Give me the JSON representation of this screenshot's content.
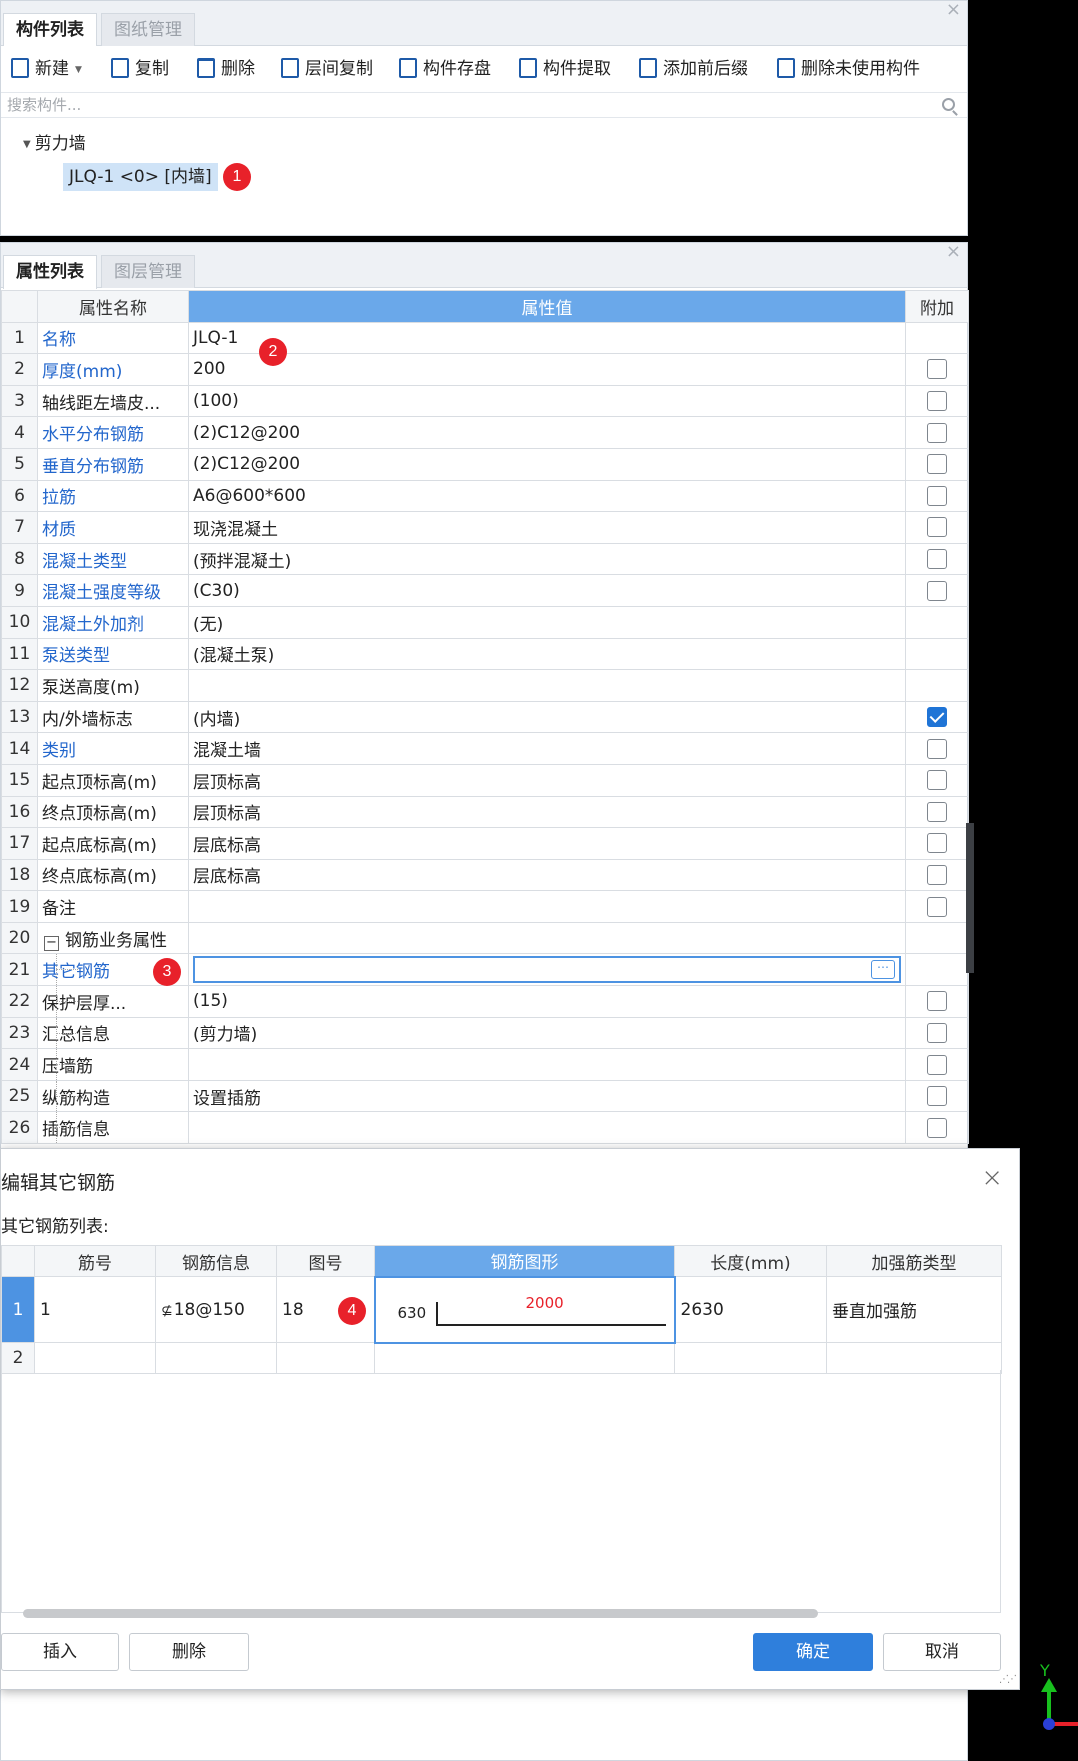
{
  "component_panel": {
    "tabs": [
      "构件列表",
      "图纸管理"
    ],
    "close_icon": "×",
    "toolbar": {
      "new": "新建",
      "copy": "复制",
      "delete": "删除",
      "floor_copy": "层间复制",
      "save": "构件存盘",
      "extract": "构件提取",
      "add_prefix_suffix": "添加前后缀",
      "delete_unused": "删除未使用构件"
    },
    "search_placeholder": "搜索构件...",
    "tree": {
      "group": "剪力墙",
      "item": "JLQ-1 <0> [内墙]"
    }
  },
  "property_panel": {
    "tabs": [
      "属性列表",
      "图层管理"
    ],
    "close_icon": "×",
    "headers": {
      "name": "属性名称",
      "value": "属性值",
      "extra": "附加"
    },
    "rows": [
      {
        "no": "1",
        "name": "名称",
        "value": "JLQ-1"
      },
      {
        "no": "2",
        "name": "厚度(mm)",
        "value": "200"
      },
      {
        "no": "3",
        "name": "轴线距左墙皮...",
        "value": "(100)"
      },
      {
        "no": "4",
        "name": "水平分布钢筋",
        "value": "(2)C12@200"
      },
      {
        "no": "5",
        "name": "垂直分布钢筋",
        "value": "(2)C12@200"
      },
      {
        "no": "6",
        "name": "拉筋",
        "value": "A6@600*600"
      },
      {
        "no": "7",
        "name": "材质",
        "value": "现浇混凝土"
      },
      {
        "no": "8",
        "name": "混凝土类型",
        "value": "(预拌混凝土)"
      },
      {
        "no": "9",
        "name": "混凝土强度等级",
        "value": "(C30)"
      },
      {
        "no": "10",
        "name": "混凝土外加剂",
        "value": "(无)"
      },
      {
        "no": "11",
        "name": "泵送类型",
        "value": "(混凝土泵)"
      },
      {
        "no": "12",
        "name": "泵送高度(m)",
        "value": ""
      },
      {
        "no": "13",
        "name": "内/外墙标志",
        "value": "(内墙)"
      },
      {
        "no": "14",
        "name": "类别",
        "value": "混凝土墙"
      },
      {
        "no": "15",
        "name": "起点顶标高(m)",
        "value": "层顶标高"
      },
      {
        "no": "16",
        "name": "终点顶标高(m)",
        "value": "层顶标高"
      },
      {
        "no": "17",
        "name": "起点底标高(m)",
        "value": "层底标高"
      },
      {
        "no": "18",
        "name": "终点底标高(m)",
        "value": "层底标高"
      },
      {
        "no": "19",
        "name": "备注",
        "value": ""
      },
      {
        "no": "20",
        "name": "钢筋业务属性",
        "value": ""
      },
      {
        "no": "21",
        "name": "其它钢筋",
        "value": ""
      },
      {
        "no": "22",
        "name": "保护层厚...",
        "value": "(15)"
      },
      {
        "no": "23",
        "name": "汇总信息",
        "value": "(剪力墙)"
      },
      {
        "no": "24",
        "name": "压墙筋",
        "value": ""
      },
      {
        "no": "25",
        "name": "纵筋构造",
        "value": "设置插筋"
      },
      {
        "no": "26",
        "name": "插筋信息",
        "value": ""
      }
    ],
    "collapse_symbol": "−",
    "ellipsis": "⋯"
  },
  "dialog": {
    "title": "编辑其它钢筋",
    "close_icon": "×",
    "list_label": "其它钢筋列表:",
    "headers": [
      "筋号",
      "钢筋信息",
      "图号",
      "钢筋图形",
      "长度(mm)",
      "加强筋类型"
    ],
    "rows": [
      {
        "no": "1",
        "bar_no": "1",
        "grade_symbol": "⊈",
        "rebar_info": "18@150",
        "shape_no": "18",
        "shape_left": "630",
        "shape_top": "2000",
        "length": "2630",
        "type": "垂直加强筋"
      },
      {
        "no": "2"
      }
    ],
    "buttons": {
      "insert": "插入",
      "delete": "删除",
      "ok": "确定",
      "cancel": "取消"
    }
  },
  "markers": [
    "1",
    "2",
    "3",
    "4"
  ],
  "axis": {
    "y_label": "Y"
  },
  "colors": {
    "accent": "#4d93e2",
    "header_highlight": "#6aa8ea",
    "marker": "#e8212a",
    "primary_button": "#2f7fdc",
    "link_blue": "#2266cc"
  }
}
